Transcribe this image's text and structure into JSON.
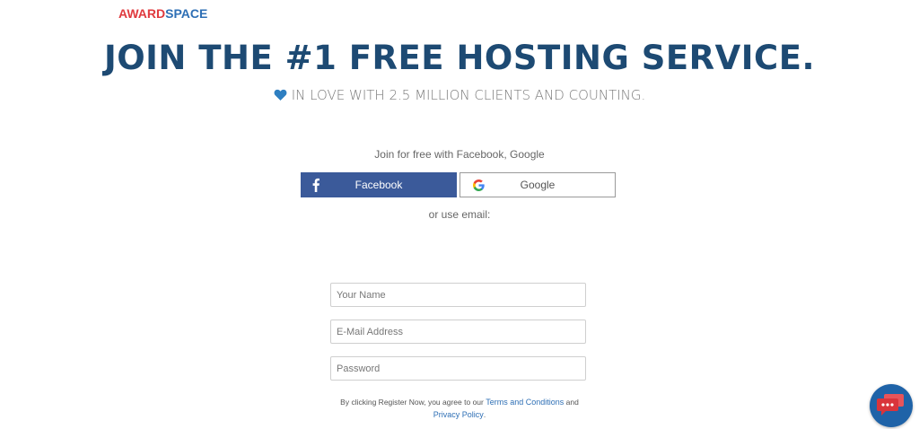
{
  "brand": {
    "logo_part1": "AWARD",
    "logo_part2": "SPACE",
    "color_red": "#e03a3e",
    "color_blue": "#2e6fb5"
  },
  "hero": {
    "headline": "JOIN THE #1 FREE HOSTING SERVICE.",
    "tagline": "IN LOVE WITH 2.5 MILLION CLIENTS AND COUNTING.",
    "tagline_icon": "heart-icon",
    "headline_color": "#1d4a73"
  },
  "social": {
    "intro": "Join for free with Facebook, Google",
    "facebook_label": "Facebook",
    "facebook_icon": "facebook-icon",
    "facebook_color": "#3b5a9a",
    "google_label": "Google",
    "google_icon": "google-icon",
    "or_email": "or use email:"
  },
  "form": {
    "name_placeholder": "Your Name",
    "email_placeholder": "E-Mail Address",
    "password_placeholder": "Password"
  },
  "legal": {
    "prefix": "By clicking Register Now, you agree to our ",
    "terms_link": "Terms and Conditions",
    "and": " and",
    "privacy_link": "Privacy Policy",
    "suffix": "."
  },
  "chat": {
    "icon": "chat-icon",
    "color": "#1f63a8"
  }
}
